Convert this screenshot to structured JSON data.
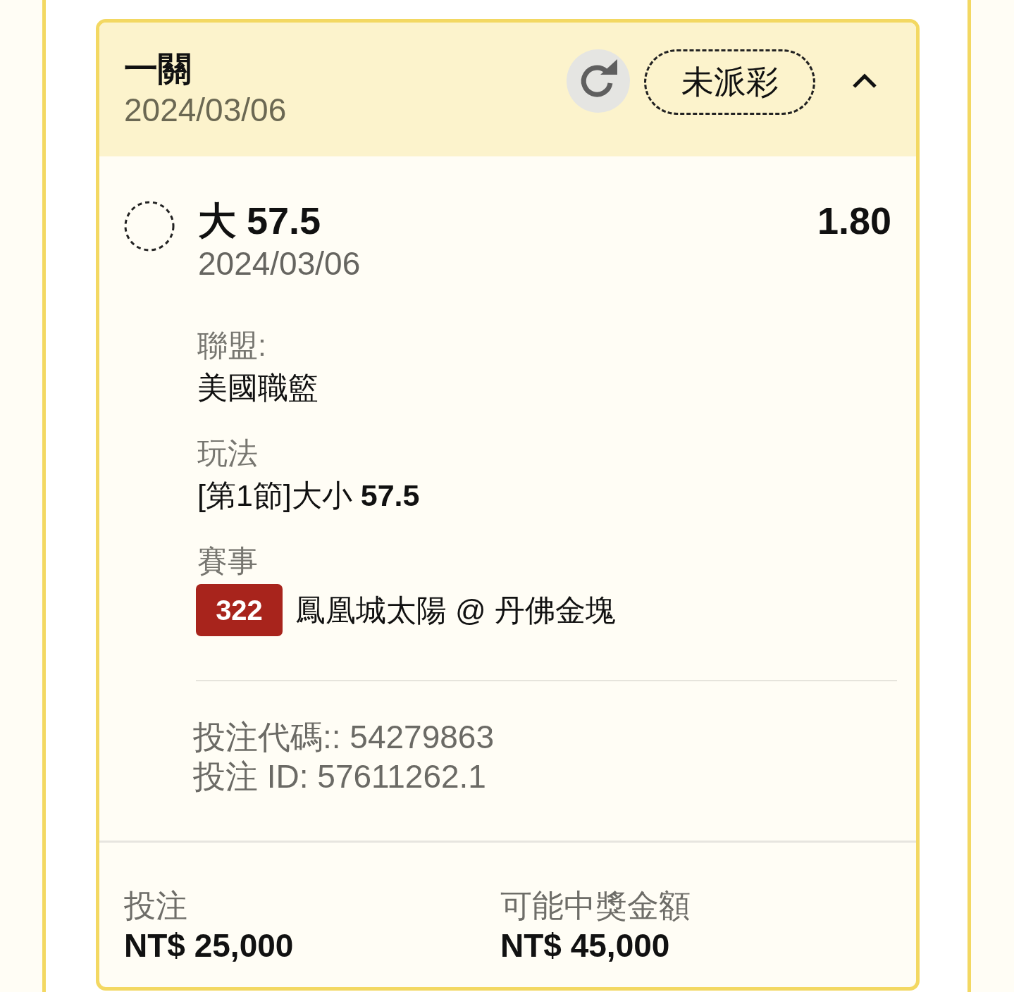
{
  "bet_card": {
    "title": "一關",
    "date": "2024/03/06",
    "status": "未派彩",
    "expanded": true
  },
  "selection": {
    "pick": "大 57.5",
    "date": "2024/03/06",
    "odds": "1.80"
  },
  "details": [
    {
      "kind": "text",
      "label": "聯盟:",
      "value": "美國職籃"
    },
    {
      "kind": "text",
      "label": "玩法",
      "value": "[第1節]大小 **57.5**"
    },
    {
      "kind": "match",
      "label": "賽事",
      "badge": "322",
      "value": "鳳凰城太陽 @ 丹佛金塊"
    }
  ],
  "references": [
    "投注代碼:: 54279863",
    "投注 ID: 57611262.1"
  ],
  "totals": [
    {
      "label": "投注",
      "amount": "NT$ 25,000"
    },
    {
      "label": "可能中獎金額",
      "amount": "NT$ 45,000"
    }
  ]
}
